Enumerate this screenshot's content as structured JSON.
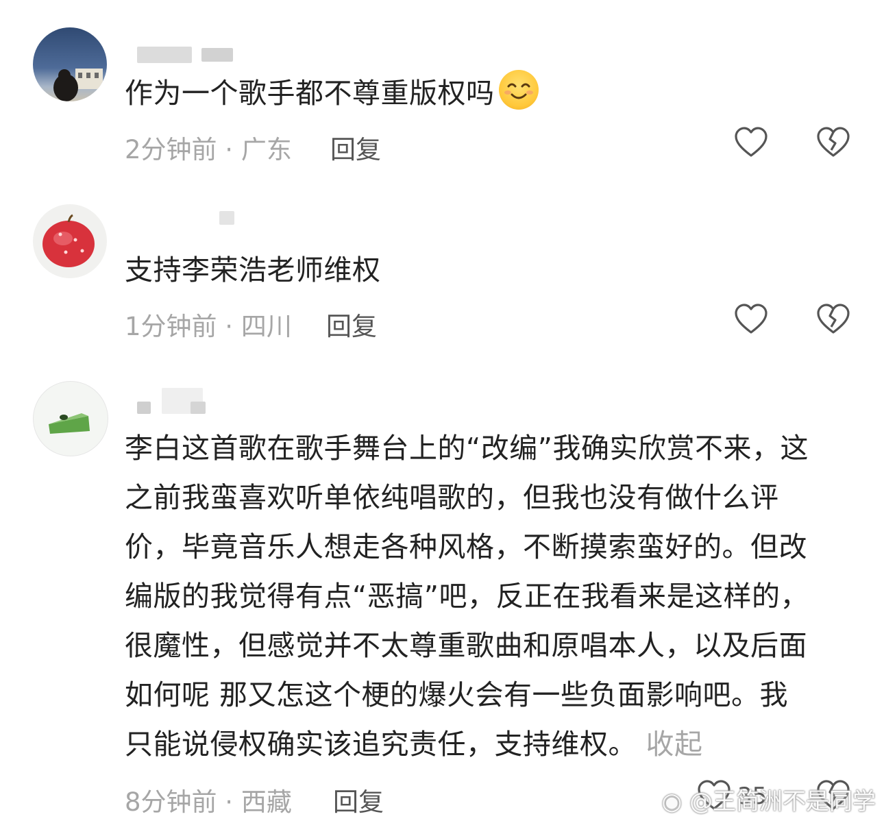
{
  "comments": [
    {
      "text": "作为一个歌手都不尊重版权吗",
      "emoji": "smiling-face-emoji",
      "time": "2分钟前",
      "location": "广东",
      "reply_label": "回复"
    },
    {
      "text": "支持李荣浩老师维权",
      "time": "1分钟前",
      "location": "四川",
      "reply_label": "回复"
    },
    {
      "lines": [
        "李白这首歌在歌手舞台上的“改编”我确实欣赏不来，这",
        "之前我蛮喜欢听单依纯唱歌的，但我也没有做什么评",
        "价，毕竟音乐人想走各种风格，不断摸索蛮好的。但改",
        "编版的我觉得有点“恶搞”吧，反正在我看来是这样的，",
        "很魔性，但感觉并不太尊重歌曲和原唱本人，以及后面",
        "如何呢 那又怎这个梗的爆火会有一些负面影响吧。我",
        "只能说侵权确实该追究责任，支持维权。"
      ],
      "collapse_label": "收起",
      "time": "8分钟前",
      "location": "西藏",
      "reply_label": "回复",
      "like_count": "35"
    }
  ],
  "separator": " · ",
  "watermark": "@王简洲不是同学",
  "icons": {
    "like": "heart-outline-icon",
    "dislike": "broken-heart-icon"
  }
}
